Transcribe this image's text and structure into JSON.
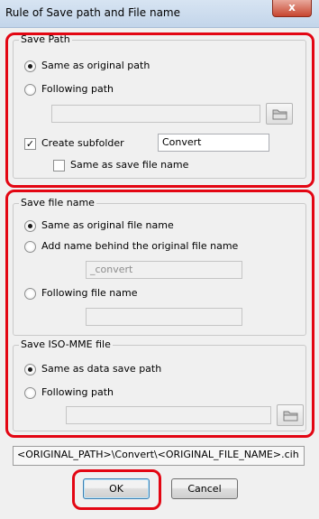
{
  "window": {
    "title": "Rule of Save path and File name",
    "close_glyph": "x"
  },
  "save_path": {
    "legend": "Save Path",
    "opt_same": "Same as original path",
    "opt_following": "Following path",
    "path_value": "",
    "browse_icon": "folder-icon",
    "create_subfolder_label": "Create subfolder",
    "create_subfolder_checked": true,
    "subfolder_value": "Convert",
    "same_as_save_name_label": "Same as save file name",
    "same_as_save_name_checked": false
  },
  "save_file_name": {
    "legend": "Save file name",
    "opt_same": "Same as original file name",
    "opt_add_behind": "Add name behind the original file name",
    "suffix_value": "_convert",
    "opt_following": "Following file name",
    "following_value": ""
  },
  "iso_mme": {
    "legend": "Save ISO-MME file",
    "opt_same": "Same as data save path",
    "opt_following": "Following path",
    "path_value": "",
    "browse_icon": "folder-icon"
  },
  "preview_path": "<ORIGINAL_PATH>\\Convert\\<ORIGINAL_FILE_NAME>.cih",
  "buttons": {
    "ok": "OK",
    "cancel": "Cancel"
  },
  "highlight_color": "#e30613"
}
